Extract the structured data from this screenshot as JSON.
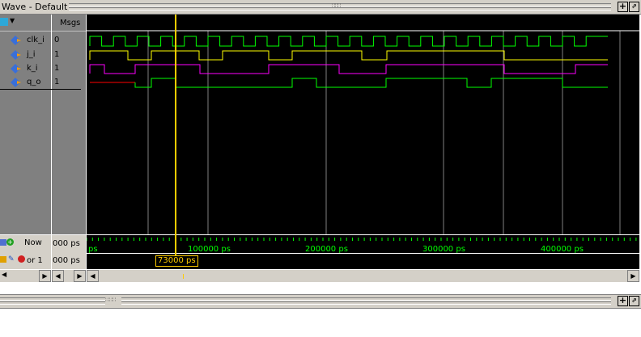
{
  "window": {
    "title": "Wave - Default"
  },
  "columns": {
    "msgs_header": "Msgs"
  },
  "signals": [
    {
      "name": "clk_i",
      "value": "0"
    },
    {
      "name": "j_i",
      "value": "1"
    },
    {
      "name": "k_i",
      "value": "1"
    },
    {
      "name": "q_o",
      "value": "1"
    }
  ],
  "cursors": {
    "now_label": "Now",
    "now_value": "000 ps",
    "cursor_label": "or 1",
    "cursor_value": "000 ps",
    "cursor_time": "73000 ps"
  },
  "timeline": {
    "ticks": [
      "ps",
      "100000 ps",
      "200000 ps",
      "300000 ps",
      "400000 ps"
    ]
  },
  "colors": {
    "clock": "#00ff00",
    "j": "#ffff00",
    "k": "#ff00ff",
    "q": "#00ff00",
    "q_early": "#ff0000",
    "cursor": "#ffcc00",
    "grid": "#808080"
  },
  "icons": {
    "plus": "plus-icon",
    "undock": "undock-icon",
    "signal": "signal-diamond-icon"
  }
}
